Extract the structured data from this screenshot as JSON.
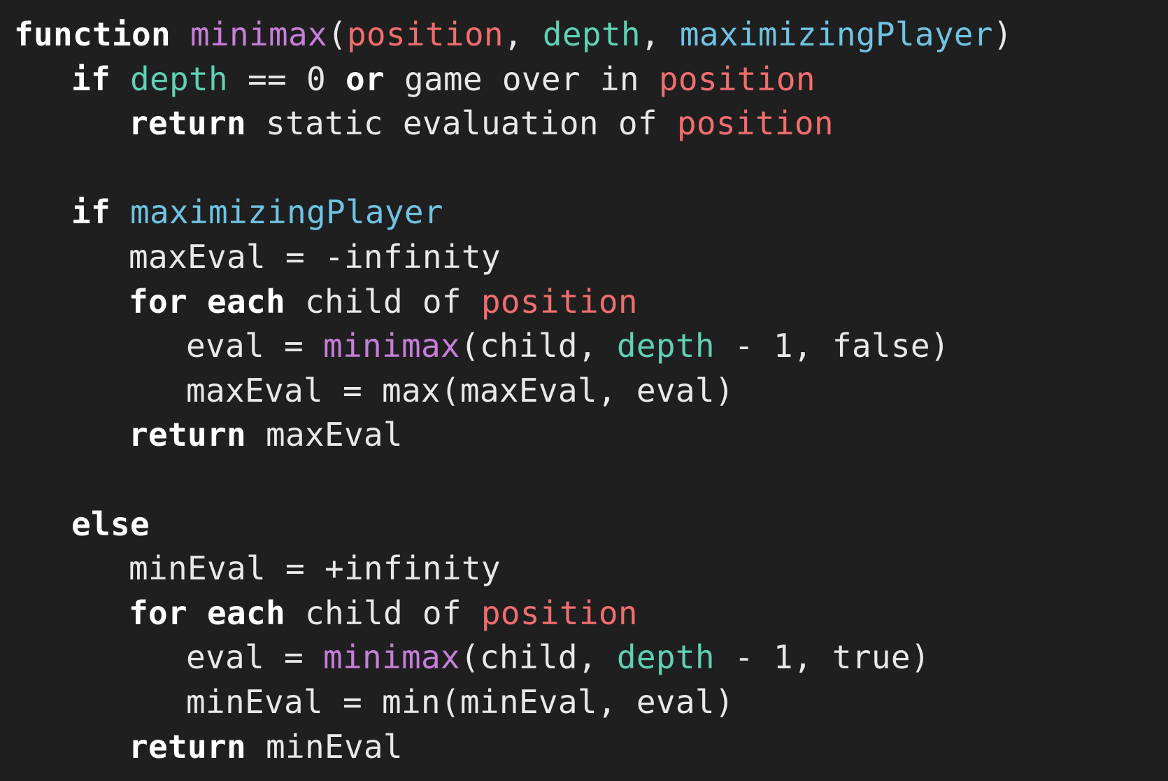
{
  "colors": {
    "background": "#1f1f1f",
    "keyword": "#ffffff",
    "function_name": "#c77dda",
    "position_param": "#f26d6d",
    "depth_param": "#5fd1b4",
    "maximizing_param": "#6fc3e3",
    "plain_text": "#e8e8e8"
  },
  "code": {
    "l1": {
      "kw": "function",
      "fn": "minimax",
      "open": "(",
      "p1": "position",
      "c1": ", ",
      "p2": "depth",
      "c2": ", ",
      "p3": "maximizingPlayer",
      "close": ")"
    },
    "l2": {
      "kw1": "if",
      "p": "depth",
      "t1": " == 0 ",
      "kw2": "or",
      "t2": " game over in ",
      "pos": "position"
    },
    "l3": {
      "kw": "return",
      "t": " static evaluation of ",
      "pos": "position"
    },
    "l5": {
      "kw": "if",
      "mp": "maximizingPlayer"
    },
    "l6": {
      "t": "maxEval = -infinity"
    },
    "l7": {
      "kw1": "for",
      "kw2": "each",
      "t": " child of ",
      "pos": "position"
    },
    "l8": {
      "t1": "eval = ",
      "fn": "minimax",
      "t2": "(child, ",
      "dep": "depth",
      "t3": " - 1, false)"
    },
    "l9": {
      "t": "maxEval = max(maxEval, eval)"
    },
    "l10": {
      "kw": "return",
      "t": " maxEval"
    },
    "l12": {
      "kw": "else"
    },
    "l13": {
      "t": "minEval = +infinity"
    },
    "l14": {
      "kw1": "for",
      "kw2": "each",
      "t": " child of ",
      "pos": "position"
    },
    "l15": {
      "t1": "eval = ",
      "fn": "minimax",
      "t2": "(child, ",
      "dep": "depth",
      "t3": " - 1, true)"
    },
    "l16": {
      "t": "minEval = min(minEval, eval)"
    },
    "l17": {
      "kw": "return",
      "t": " minEval"
    }
  }
}
